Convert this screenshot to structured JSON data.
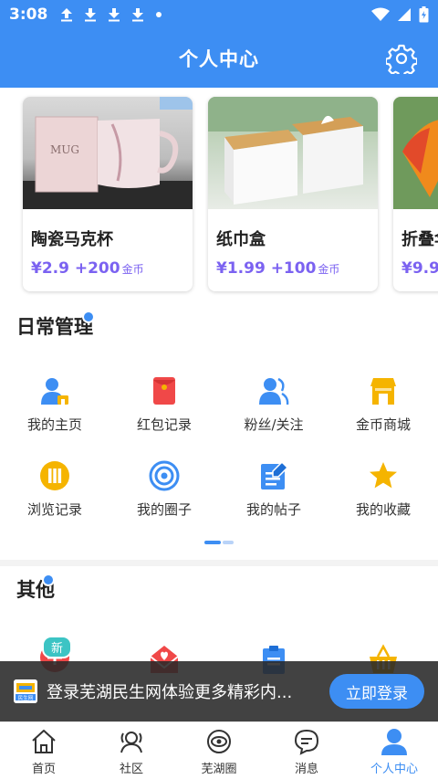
{
  "status_bar": {
    "time": "3:08"
  },
  "header": {
    "title": "个人中心"
  },
  "products": [
    {
      "name": "陶瓷马克杯",
      "price": "¥2.9 +200",
      "currency": "金币",
      "mug_text": "MUG"
    },
    {
      "name": "纸巾盒",
      "price": "¥1.99 +100",
      "currency": "金币"
    },
    {
      "name": "折叠伞",
      "price": "¥9.9",
      "currency": ""
    }
  ],
  "daily": {
    "title": "日常管理",
    "items": [
      {
        "label": "我的主页",
        "icon": "user-home-icon"
      },
      {
        "label": "红包记录",
        "icon": "red-envelope-icon"
      },
      {
        "label": "粉丝/关注",
        "icon": "fans-icon"
      },
      {
        "label": "金币商城",
        "icon": "shop-icon"
      },
      {
        "label": "浏览记录",
        "icon": "history-icon"
      },
      {
        "label": "我的圈子",
        "icon": "circle-icon"
      },
      {
        "label": "我的帖子",
        "icon": "post-icon"
      },
      {
        "label": "我的收藏",
        "icon": "star-icon"
      }
    ]
  },
  "other": {
    "title": "其他",
    "new_badge": "新",
    "items": [
      {
        "label": "",
        "icon": "add-icon"
      },
      {
        "label": "",
        "icon": "mail-heart-icon"
      },
      {
        "label": "",
        "icon": "clipboard-icon"
      },
      {
        "label": "",
        "icon": "basket-icon"
      }
    ]
  },
  "login_banner": {
    "logo_text": "民生网",
    "text": "登录芜湖民生网体验更多精彩内...",
    "button": "立即登录"
  },
  "tabbar": {
    "items": [
      {
        "label": "首页",
        "icon": "home-icon"
      },
      {
        "label": "社区",
        "icon": "community-icon"
      },
      {
        "label": "芜湖圈",
        "icon": "wuhu-circle-icon"
      },
      {
        "label": "消息",
        "icon": "message-icon"
      },
      {
        "label": "个人中心",
        "icon": "profile-icon",
        "active": true
      }
    ]
  },
  "colors": {
    "primary": "#3d8ef3",
    "price": "#7b62f1",
    "gold": "#f5b400",
    "red": "#f04848",
    "badge": "#3cc4c4"
  }
}
